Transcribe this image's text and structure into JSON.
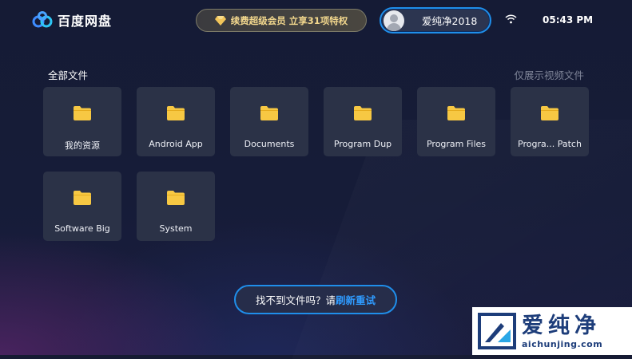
{
  "header": {
    "app_title": "百度网盘",
    "vip_banner": "续费超级会员 立享31项特权",
    "username": "爱纯净2018",
    "time": "05:43 PM"
  },
  "section": {
    "title": "全部文件",
    "filter_label": "仅展示视频文件"
  },
  "folders": [
    {
      "label": "我的资源"
    },
    {
      "label": "Android App"
    },
    {
      "label": "Documents"
    },
    {
      "label": "Program Dup"
    },
    {
      "label": "Program Files"
    },
    {
      "label": "Progra... Patch"
    },
    {
      "label": "Software Big"
    },
    {
      "label": "System"
    }
  ],
  "retry": {
    "prefix": "找不到文件吗？请",
    "link": "刷新重试"
  },
  "watermark": {
    "brand": "爱纯净",
    "url": "aichunjing.com"
  },
  "colors": {
    "accent": "#1f8eea",
    "folder": "#f7c843",
    "vip_gold": "#f2d78d"
  }
}
